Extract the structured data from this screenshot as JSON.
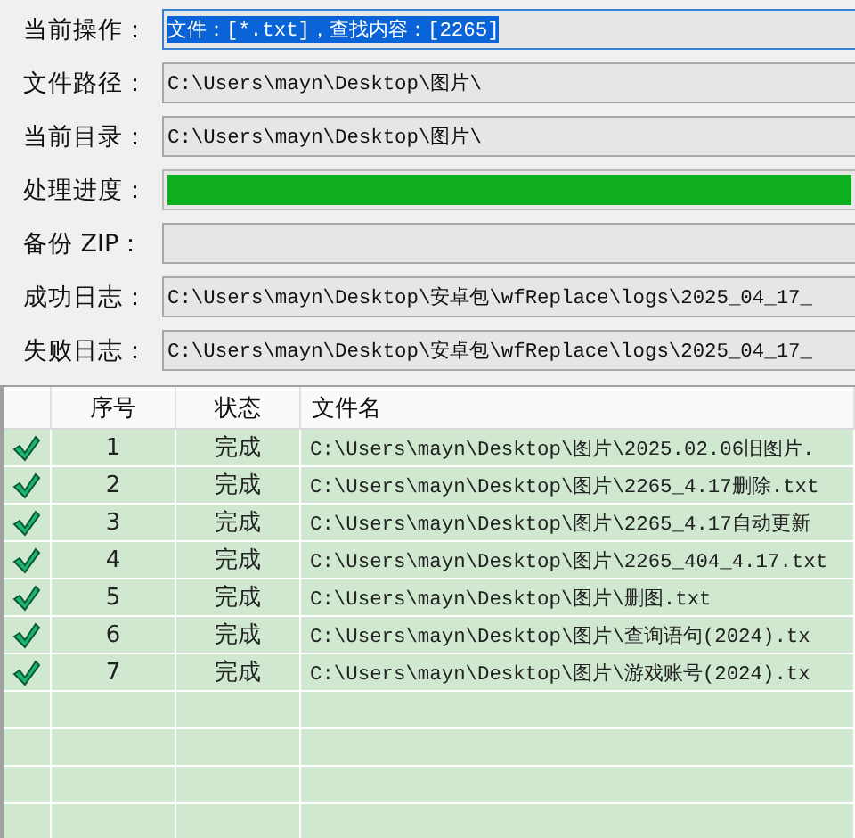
{
  "form": [
    {
      "label": "当前操作：",
      "kind": "text",
      "value": "文件：[*.txt]，查找内容：[2265]",
      "text_selected": true
    },
    {
      "label": "文件路径：",
      "kind": "text",
      "value": "C:\\Users\\mayn\\Desktop\\图片\\"
    },
    {
      "label": "当前目录：",
      "kind": "text",
      "value": "C:\\Users\\mayn\\Desktop\\图片\\"
    },
    {
      "label": "处理进度：",
      "kind": "progress",
      "level": 1
    },
    {
      "label": "备份 ZIP：",
      "kind": "text"
    },
    {
      "label": "成功日志：",
      "kind": "text",
      "value": "C:\\Users\\mayn\\Desktop\\安卓包\\wfReplace\\logs\\2025_04_17_"
    },
    {
      "label": "失败日志：",
      "kind": "text",
      "value": "C:\\Users\\mayn\\Desktop\\安卓包\\wfReplace\\logs\\2025_04_17_"
    }
  ],
  "table": {
    "columns": [
      "序号",
      "状态",
      "文件名"
    ],
    "rows": [
      {
        "checked": true,
        "index": "1",
        "status": "完成",
        "file": "C:\\Users\\mayn\\Desktop\\图片\\2025.02.06旧图片."
      },
      {
        "checked": true,
        "index": "2",
        "status": "完成",
        "file": "C:\\Users\\mayn\\Desktop\\图片\\2265_4.17删除.txt"
      },
      {
        "checked": true,
        "index": "3",
        "status": "完成",
        "file": "C:\\Users\\mayn\\Desktop\\图片\\2265_4.17自动更新"
      },
      {
        "checked": true,
        "index": "4",
        "status": "完成",
        "file": "C:\\Users\\mayn\\Desktop\\图片\\2265_404_4.17.txt"
      },
      {
        "checked": true,
        "index": "5",
        "status": "完成",
        "file": "C:\\Users\\mayn\\Desktop\\图片\\删图.txt"
      },
      {
        "checked": true,
        "index": "6",
        "status": "完成",
        "file": "C:\\Users\\mayn\\Desktop\\图片\\查询语句(2024).tx"
      },
      {
        "checked": true,
        "index": "7",
        "status": "完成",
        "file": "C:\\Users\\mayn\\Desktop\\图片\\游戏账号(2024).tx"
      }
    ]
  }
}
